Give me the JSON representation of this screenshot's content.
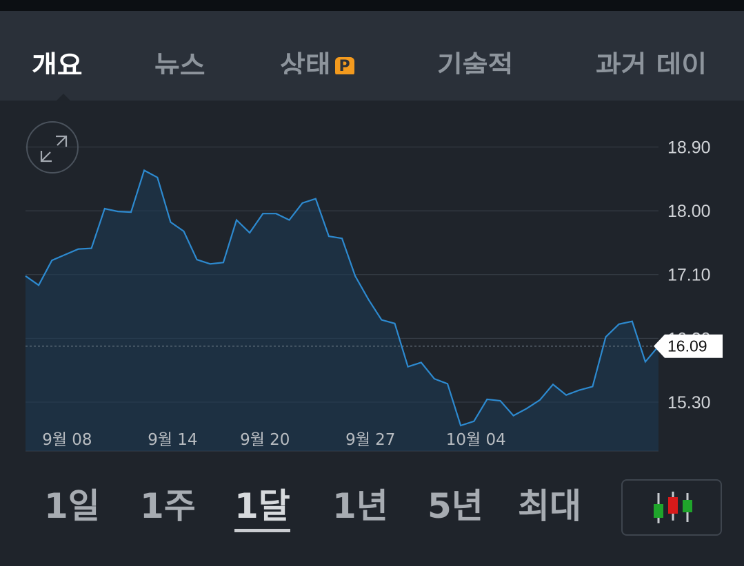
{
  "tabs": [
    {
      "label": "개요",
      "active": true
    },
    {
      "label": "뉴스",
      "active": false
    },
    {
      "label": "상태",
      "active": false,
      "badge": "P"
    },
    {
      "label": "기술적",
      "active": false
    },
    {
      "label": "과거 데이",
      "active": false
    }
  ],
  "chart_data": {
    "type": "area",
    "x_tick_labels": [
      "9월 08",
      "9월 14",
      "9월 20",
      "9월 27",
      "10월 04"
    ],
    "y_tick_labels": [
      "18.90",
      "18.00",
      "17.10",
      "16.20",
      "15.30"
    ],
    "ylim": [
      14.97,
      19.05
    ],
    "current_value": 16.09,
    "current_label": "16.09",
    "series": [
      {
        "values": [
          17.08,
          16.95,
          17.3,
          17.38,
          17.46,
          17.47,
          18.03,
          17.99,
          17.98,
          18.57,
          18.47,
          17.84,
          17.71,
          17.31,
          17.25,
          17.27,
          17.87,
          17.69,
          17.96,
          17.96,
          17.87,
          18.11,
          18.17,
          17.64,
          17.61,
          17.08,
          16.75,
          16.46,
          16.41,
          15.8,
          15.86,
          15.63,
          15.56,
          14.97,
          15.03,
          15.34,
          15.32,
          15.11,
          15.21,
          15.33,
          15.55,
          15.4,
          15.47,
          15.52,
          16.22,
          16.4,
          16.44,
          15.87,
          16.09
        ]
      }
    ],
    "line_color": "#2d8ad0",
    "area_color": "#1b3b56"
  },
  "ranges": [
    "1일",
    "1주",
    "1달",
    "1년",
    "5년",
    "최대"
  ],
  "active_range": "1달"
}
